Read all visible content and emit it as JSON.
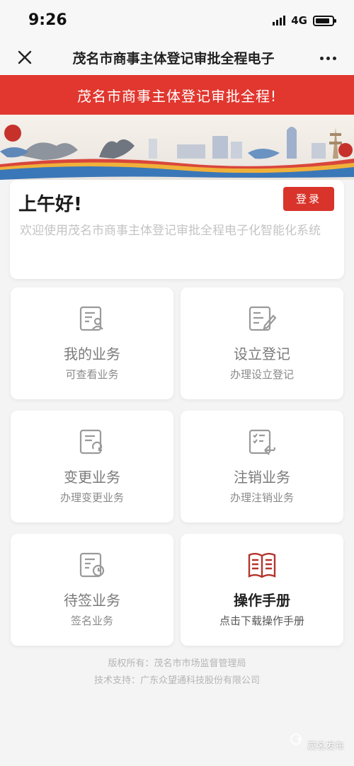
{
  "status_bar": {
    "time": "9:26",
    "network": "4G"
  },
  "nav": {
    "title": "茂名市商事主体登记审批全程电子"
  },
  "header": {
    "title": "茂名市商事主体登记审批全程!"
  },
  "greeting": {
    "title": "上午好!",
    "login_label": "登录",
    "subtitle": "欢迎使用茂名市商事主体登记审批全程电子化智能化系统"
  },
  "tiles": [
    {
      "title": "我的业务",
      "subtitle": "可查看业务",
      "icon": "document-user-icon"
    },
    {
      "title": "设立登记",
      "subtitle": "办理设立登记",
      "icon": "document-edit-icon"
    },
    {
      "title": "变更业务",
      "subtitle": "办理变更业务",
      "icon": "document-refresh-icon"
    },
    {
      "title": "注销业务",
      "subtitle": "办理注销业务",
      "icon": "document-return-icon"
    },
    {
      "title": "待签业务",
      "subtitle": "签名业务",
      "icon": "document-clock-icon"
    },
    {
      "title": "操作手册",
      "subtitle": "点击下载操作手册",
      "icon": "book-icon"
    }
  ],
  "footer": {
    "copyright": "版权所有：茂名市市场监督管理局",
    "support": "技术支持：广东众望通科技股份有限公司"
  },
  "watermark": {
    "text": "茂名发布"
  },
  "colors": {
    "accent": "#e1372f",
    "button": "#d9342b",
    "background": "#f4f4f4"
  }
}
